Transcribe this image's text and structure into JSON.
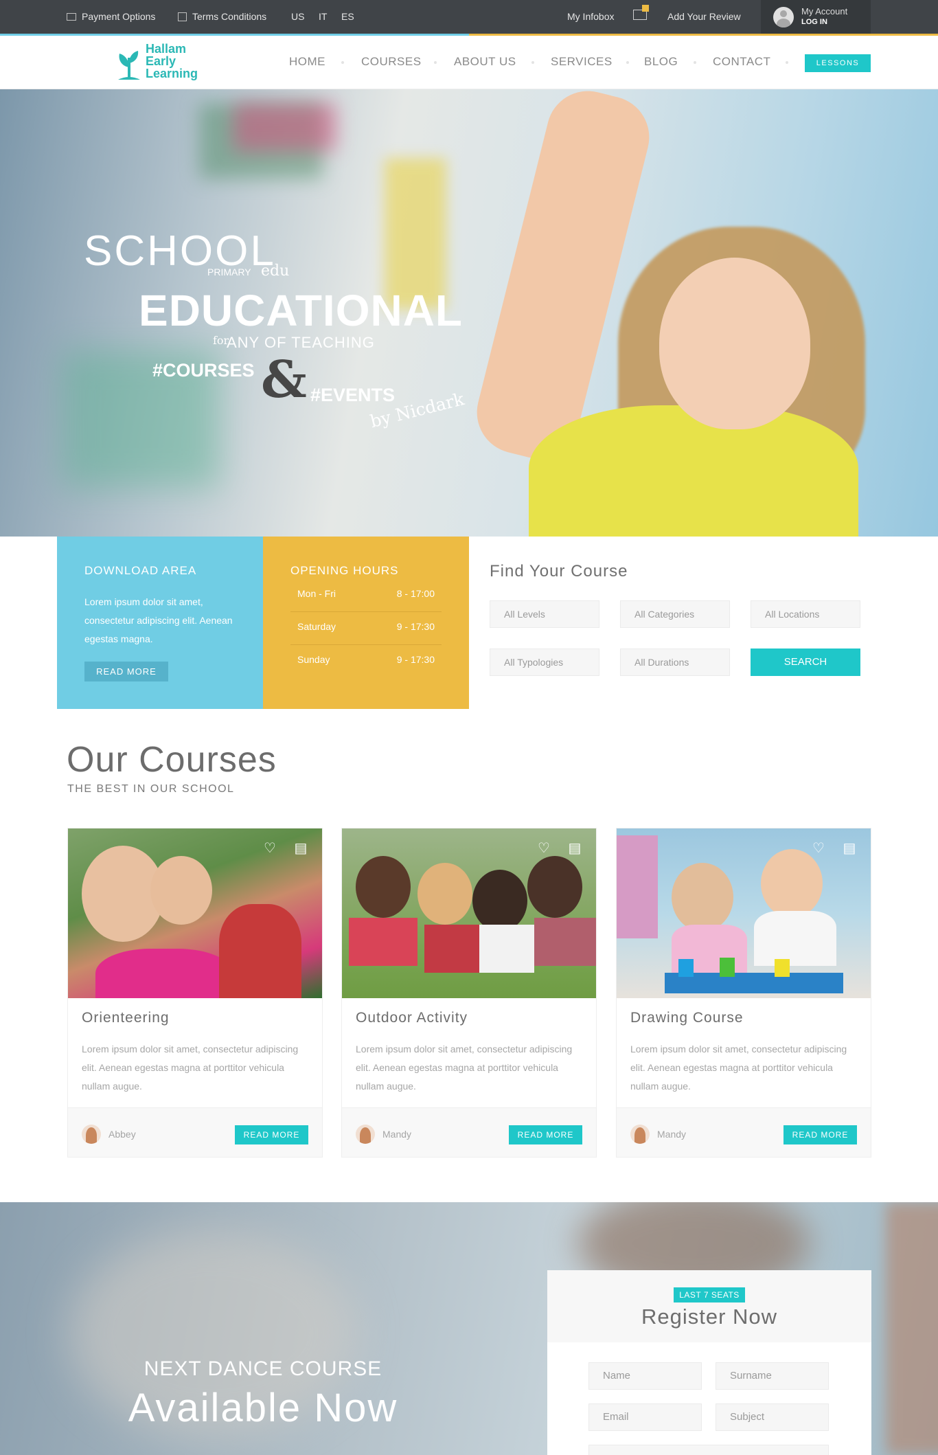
{
  "topbar": {
    "payment_options": "Payment Options",
    "terms_conditions": "Terms Conditions",
    "languages": [
      "US",
      "IT",
      "ES"
    ],
    "my_infobox": "My Infobox",
    "add_review": "Add Your Review",
    "account_label": "My Account",
    "login_label": "LOG IN"
  },
  "logo": {
    "line1": "Hallam",
    "line2": "Early",
    "line3": "Learning",
    "color": "#2bb8b5"
  },
  "nav": {
    "items": [
      "HOME",
      "COURSES",
      "ABOUT US",
      "SERVICES",
      "BLOG",
      "CONTACT"
    ],
    "cta": "LESSONS"
  },
  "hero": {
    "school": "SCHOOL",
    "primary": "PRIMARY",
    "edu": "edu",
    "educational": "EDUCATIONAL",
    "for": "for",
    "any_of_teaching": "ANY OF TEACHING",
    "courses": "#COURSES",
    "amp": "&",
    "events": "#EVENTS",
    "by": "by Nicdark"
  },
  "download": {
    "title": "DOWNLOAD AREA",
    "text": "Lorem ipsum dolor sit amet, consectetur adipiscing elit. Aenean egestas magna.",
    "button": "READ MORE"
  },
  "hours": {
    "title": "OPENING HOURS",
    "rows": [
      {
        "day": "Mon - Fri",
        "time": "8 - 17:00"
      },
      {
        "day": "Saturday",
        "time": "9 - 17:30"
      },
      {
        "day": "Sunday",
        "time": "9 - 17:30"
      }
    ]
  },
  "find": {
    "title": "Find Your Course",
    "fields": [
      "All Levels",
      "All Categories",
      "All Locations",
      "All Typologies",
      "All Durations"
    ],
    "search": "SEARCH"
  },
  "courses": {
    "title": "Our Courses",
    "subtitle": "THE BEST IN OUR SCHOOL",
    "cards": [
      {
        "name": "Orienteering",
        "desc": "Lorem ipsum dolor sit amet, consectetur adipiscing elit. Aenean egestas magna at porttitor vehicula nullam augue.",
        "author": "Abbey",
        "button": "READ MORE"
      },
      {
        "name": "Outdoor Activity",
        "desc": "Lorem ipsum dolor sit amet, consectetur adipiscing elit. Aenean egestas magna at porttitor vehicula nullam augue.",
        "author": "Mandy",
        "button": "READ MORE"
      },
      {
        "name": "Drawing Course",
        "desc": "Lorem ipsum dolor sit amet, consectetur adipiscing elit. Aenean egestas magna at porttitor vehicula nullam augue.",
        "author": "Mandy",
        "button": "READ MORE"
      }
    ]
  },
  "promo": {
    "next": "NEXT DANCE COURSE",
    "available": "Available Now"
  },
  "register": {
    "badge": "LAST 7 SEATS",
    "title": "Register Now",
    "fields": [
      "Name",
      "Surname",
      "Email",
      "Subject"
    ]
  },
  "colors": {
    "accent": "#1fc7c9",
    "blue_box": "#70cde4",
    "yellow_box": "#edbb43",
    "topbar": "#404448"
  }
}
